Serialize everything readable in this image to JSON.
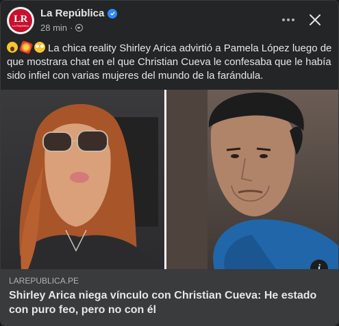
{
  "post": {
    "page_name": "La República",
    "avatar": {
      "logo_text": "LR",
      "logo_subtext": "La República"
    },
    "time": "28 min",
    "separator": "·",
    "privacy_icon": "globe-icon",
    "verified_icon": "verified-badge-icon",
    "emojis": [
      "scream-emoji",
      "collision-emoji",
      "flushed-emoji"
    ],
    "text": "La chica reality Shirley Arica advirtió a Pamela López luego de que mostrara chat en el que Christian Cueva le confesaba que le había sido infiel con varias mujeres del mundo de la farándula.",
    "more_icon": "more-options-icon",
    "close_icon": "close-icon"
  },
  "link_preview": {
    "domain": "LAREPUBLICA.PE",
    "title": "Shirley Arica niega vínculo con Christian Cueva: He estado con puro feo, pero no con él",
    "info_label": "i"
  },
  "colors": {
    "card_bg": "#242526",
    "link_bg": "#3a3b3c",
    "text_primary": "#e4e6eb",
    "text_secondary": "#b0b3b8",
    "verified": "#2d88ff",
    "brand_red": "#c8102e"
  }
}
